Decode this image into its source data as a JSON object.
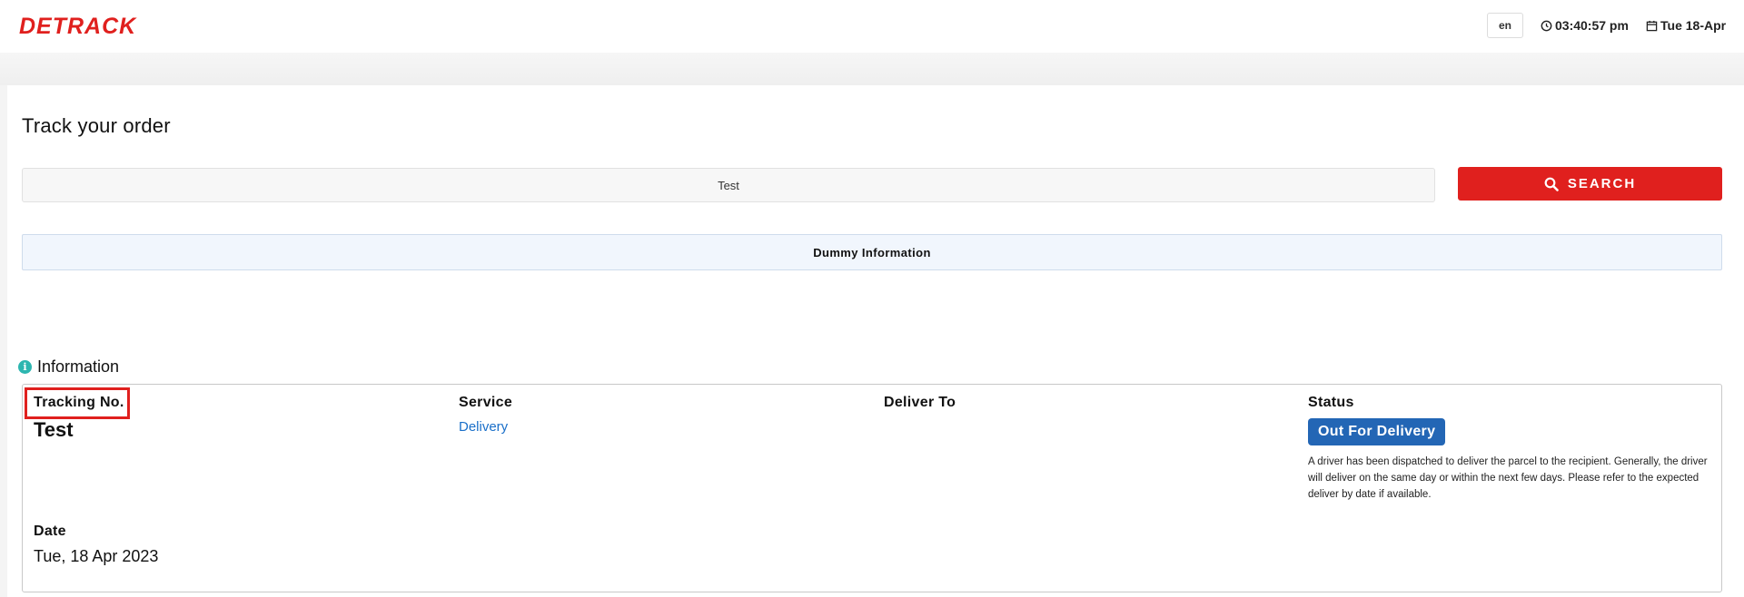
{
  "header": {
    "logo_text": "DETRACK",
    "language": "en",
    "time": "03:40:57 pm",
    "date": "Tue 18-Apr",
    "icons": {
      "clock": "clock-icon",
      "calendar": "calendar-icon"
    }
  },
  "page": {
    "title": "Track your order",
    "search": {
      "value": "Test",
      "button_label": "SEARCH",
      "icon": "search-icon"
    },
    "dummy_info": "Dummy Information"
  },
  "information": {
    "heading": "Information",
    "icon": "info-icon",
    "tracking_label": "Tracking No.",
    "tracking_value": "Test",
    "service_label": "Service",
    "service_value": "Delivery",
    "deliver_to_label": "Deliver To",
    "status_label": "Status",
    "status_value": "Out For Delivery",
    "status_description": "A driver has been dispatched to deliver the parcel to the recipient. Generally, the driver will deliver on the same day or within the next few days. Please refer to the expected deliver by date if available.",
    "date_label": "Date",
    "date_value": "Tue, 18 Apr 2023"
  },
  "colors": {
    "brand_red": "#e0201e",
    "status_blue": "#2366b5",
    "link_blue": "#1a6fc9",
    "info_teal": "#2db6b0"
  }
}
